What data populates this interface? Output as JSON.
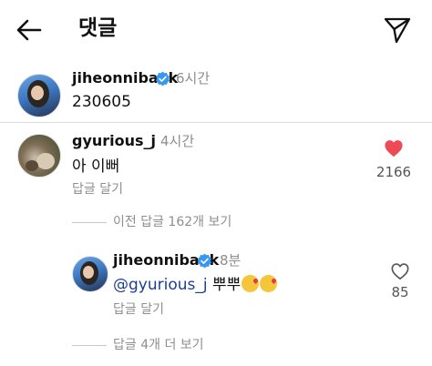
{
  "header": {
    "back_icon": "arrow-left-icon",
    "title": "댓글",
    "send_icon": "send-paper-plane-icon"
  },
  "post": {
    "username": "jiheonnibaek",
    "verified": true,
    "time": "6시간",
    "caption": "230605"
  },
  "comment": {
    "username": "gyurious_j",
    "time": "4시간",
    "text": "아 이뻐",
    "reply_label": "답글 달기",
    "like_count": "2166",
    "liked": true,
    "like_color": "#ed4956"
  },
  "thread": {
    "prev_replies_label": "이전 답글 162개 보기",
    "more_replies_label": "답글 4개 더 보기"
  },
  "reply": {
    "username": "jiheonnibaek",
    "verified": true,
    "time": "8분",
    "mention": "@gyurious_j",
    "text": "뿌뿌",
    "emojis": [
      "face-blowing-kiss",
      "face-blowing-kiss"
    ],
    "reply_label": "답글 달기",
    "like_count": "85",
    "liked": false
  },
  "colors": {
    "verified_blue": "#3897f0",
    "secondary_text": "#8e8e8e",
    "mention_link": "#1d3f8f"
  }
}
